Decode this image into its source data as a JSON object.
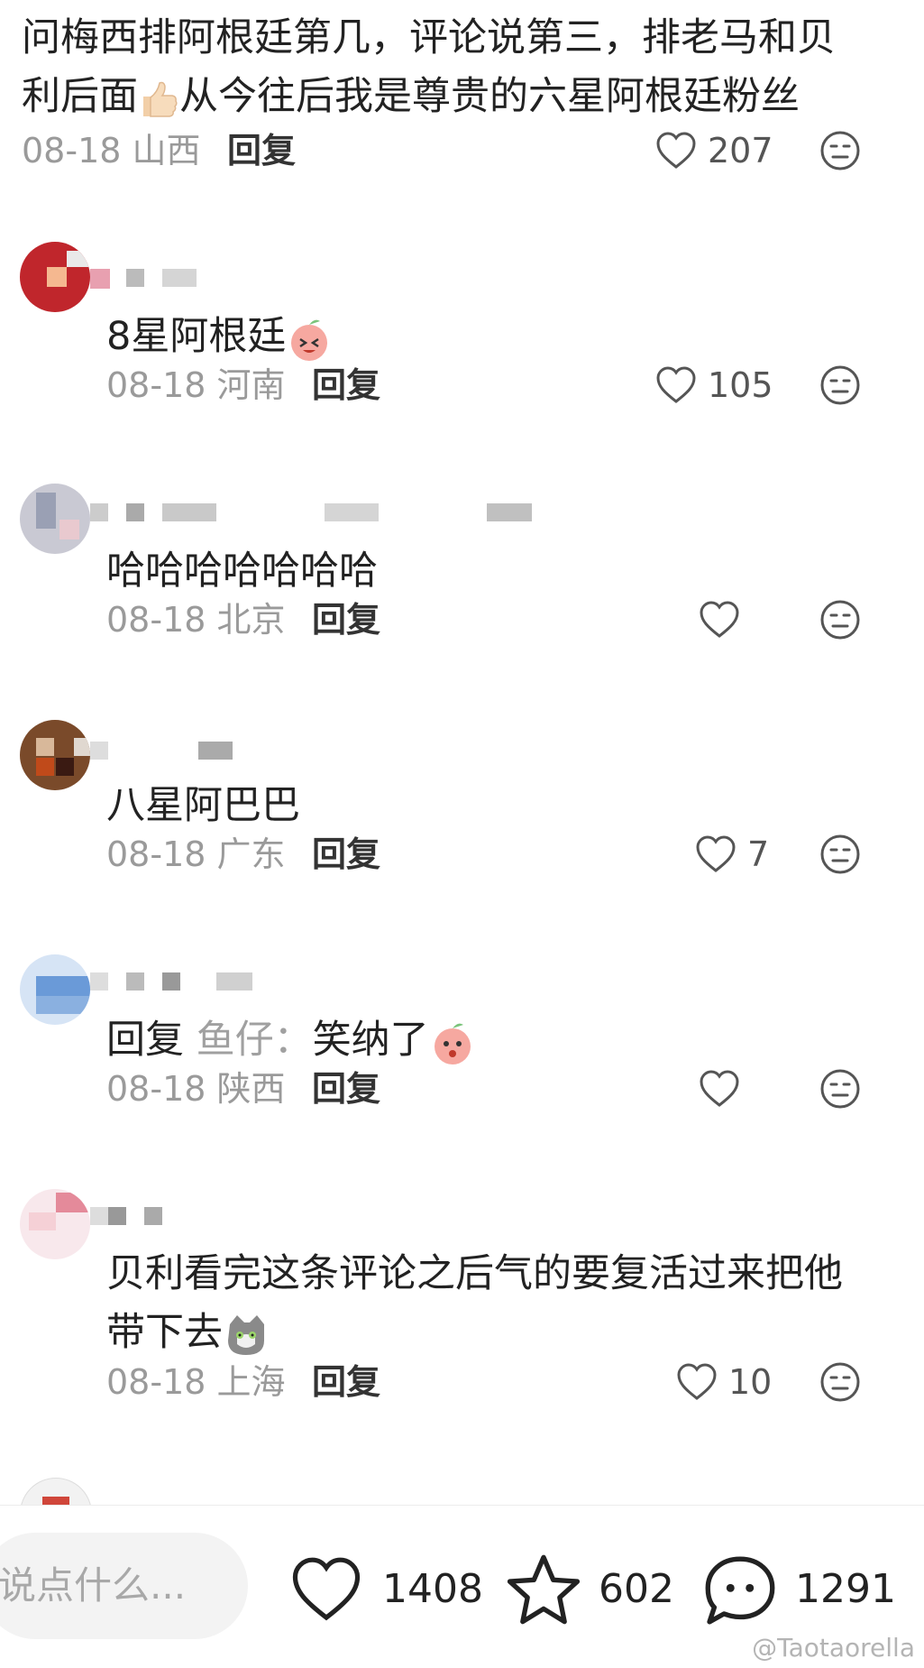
{
  "top_comment": {
    "text_line1": "问梅西排阿根廷第几，评论说第三，排老马和贝",
    "text_line2_a": "利后面",
    "text_line2_b": "从今往后我是尊贵的六星阿根廷粉丝",
    "date_location": "08-18 山西",
    "reply_label": "回复",
    "likes": "207"
  },
  "replies": [
    {
      "text": "8星阿根廷",
      "date_location": "08-18 河南",
      "reply_label": "回复",
      "likes": "105"
    },
    {
      "text": "哈哈哈哈哈哈哈",
      "date_location": "08-18 北京",
      "reply_label": "回复",
      "likes": ""
    },
    {
      "text": "八星阿巴巴",
      "date_location": "08-18 广东",
      "reply_label": "回复",
      "likes": "7"
    },
    {
      "reply_prefix": "回复",
      "reply_to": "鱼仔：",
      "text": "笑纳了",
      "date_location": "08-18 陕西",
      "reply_label": "回复",
      "likes": ""
    },
    {
      "text_line1": "贝利看完这条评论之后气的要复活过来把他",
      "text_line2": "带下去",
      "date_location": "08-18 上海",
      "reply_label": "回复",
      "likes": "10"
    }
  ],
  "bottom_bar": {
    "input_placeholder": "说点什么...",
    "likes": "1408",
    "favorites": "602",
    "comments": "1291"
  },
  "watermark": "@Taotaorella",
  "colors": {
    "text": "#222222",
    "meta": "#9a9a9a",
    "icon": "#555555"
  }
}
